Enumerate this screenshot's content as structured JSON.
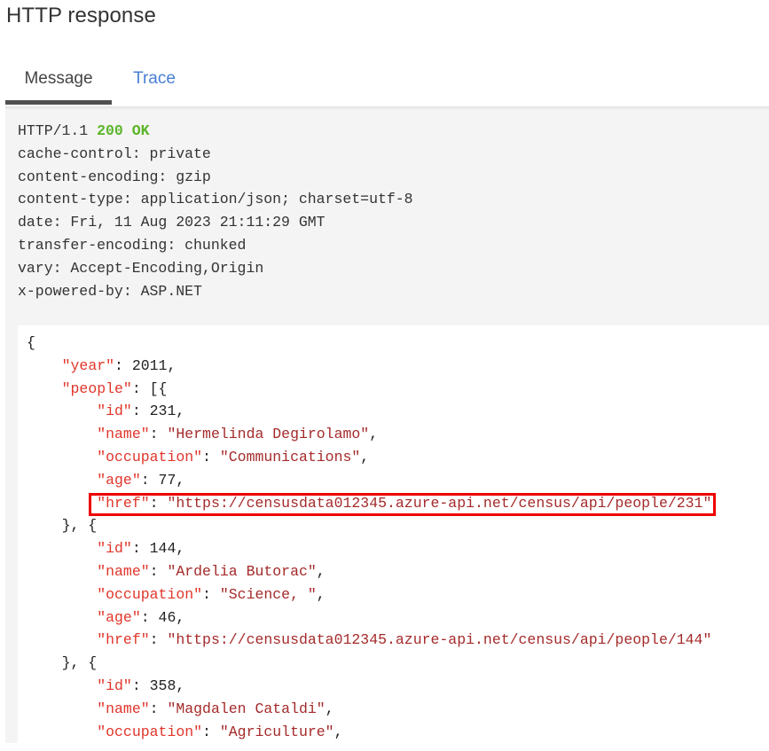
{
  "title": "HTTP response",
  "tabs": [
    {
      "label": "Message",
      "active": true
    },
    {
      "label": "Trace",
      "active": false
    }
  ],
  "response": {
    "protocol": "HTTP/1.1",
    "status": "200 OK",
    "status_color": "#5ab52a",
    "headers": [
      "cache-control: private",
      "content-encoding: gzip",
      "content-type: application/json; charset=utf-8",
      "date: Fri, 11 Aug 2023 21:11:29 GMT",
      "transfer-encoding: chunked",
      "vary: Accept-Encoding,Origin",
      "x-powered-by: ASP.NET"
    ]
  },
  "body": {
    "year": 2011,
    "people": [
      {
        "id": 231,
        "name": "Hermelinda Degirolamo",
        "occupation": "Communications",
        "age": 77,
        "href": "https://censusdata012345.azure-api.net/census/api/people/231",
        "highlighted": true
      },
      {
        "id": 144,
        "name": "Ardelia Butorac",
        "occupation": "Science, ",
        "age": 46,
        "href": "https://censusdata012345.azure-api.net/census/api/people/144"
      },
      {
        "id": 358,
        "name": "Magdalen Cataldi",
        "occupation": "Agriculture"
      }
    ]
  },
  "colors": {
    "key": "#e0362b",
    "string": "#a52a2a",
    "highlight_border": "#ee0000",
    "tab_active_underline": "#505050",
    "tab_link": "#4a7fd4"
  }
}
